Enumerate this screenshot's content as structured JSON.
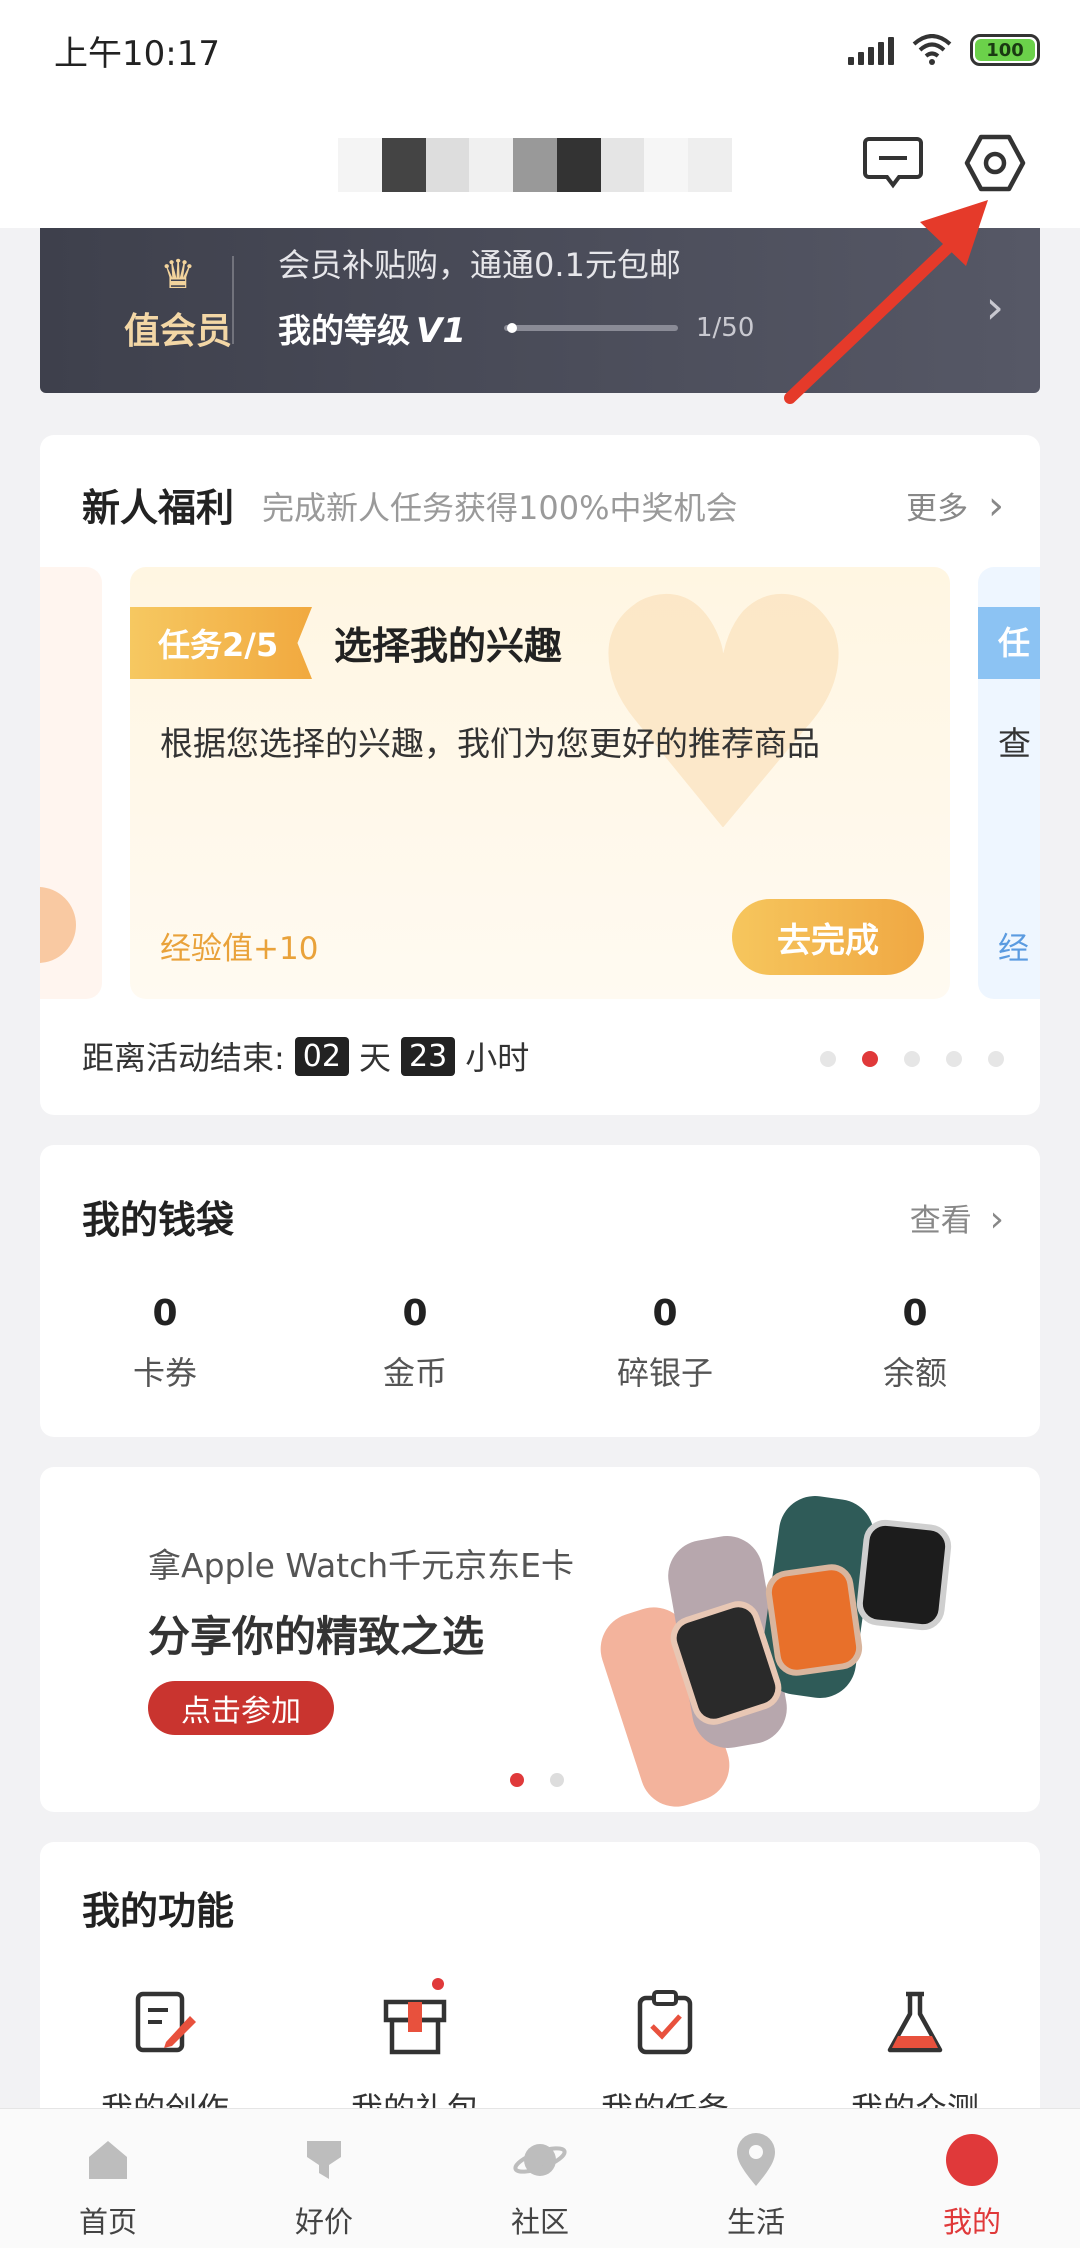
{
  "status_bar": {
    "time": "上午10:17",
    "battery": "100"
  },
  "member": {
    "badge": "值会员",
    "promo": "会员补贴购，通通0.1元包邮",
    "level_label": "我的等级",
    "level_value": "V1",
    "progress": "1/50",
    "progress_fraction": 0.02
  },
  "newcomer": {
    "title": "新人福利",
    "subtitle": "完成新人任务获得100%中奖机会",
    "more": "更多",
    "task": {
      "tag": "任务2/5",
      "name": "选择我的兴趣",
      "desc": "根据您选择的兴趣，我们为您更好的推荐商品",
      "reward": "经验值+10",
      "button": "去完成"
    },
    "peek_right": {
      "tag": "任",
      "desc": "查",
      "reward": "经"
    },
    "countdown": {
      "prefix": "距离活动结束:",
      "days": "02",
      "day_unit": "天",
      "hours": "23",
      "hour_unit": "小时"
    }
  },
  "wallet": {
    "title": "我的钱袋",
    "view": "查看",
    "items": [
      {
        "value": "0",
        "label": "卡券"
      },
      {
        "value": "0",
        "label": "金币"
      },
      {
        "value": "0",
        "label": "碎银子"
      },
      {
        "value": "0",
        "label": "余额"
      }
    ]
  },
  "banner": {
    "line1": "拿Apple Watch千元京东E卡",
    "line2": "分享你的精致之选",
    "button": "点击参加"
  },
  "functions": {
    "title": "我的功能",
    "items": [
      {
        "label": "我的创作",
        "icon": "edit-icon"
      },
      {
        "label": "我的礼包",
        "icon": "gift-box-icon"
      },
      {
        "label": "我的任务",
        "icon": "clipboard-check-icon"
      },
      {
        "label": "我的众测",
        "icon": "flask-icon"
      }
    ]
  },
  "tabbar": {
    "items": [
      {
        "label": "首页",
        "icon": "home-icon"
      },
      {
        "label": "好价",
        "icon": "price-tag-icon"
      },
      {
        "label": "社区",
        "icon": "planet-icon"
      },
      {
        "label": "生活",
        "icon": "location-pin-icon"
      },
      {
        "label": "我的",
        "icon": "profile-icon",
        "active": true
      }
    ]
  },
  "colors": {
    "accent": "#e0393a",
    "gold": "#f0a843",
    "member_bg": "#4a4c58"
  }
}
